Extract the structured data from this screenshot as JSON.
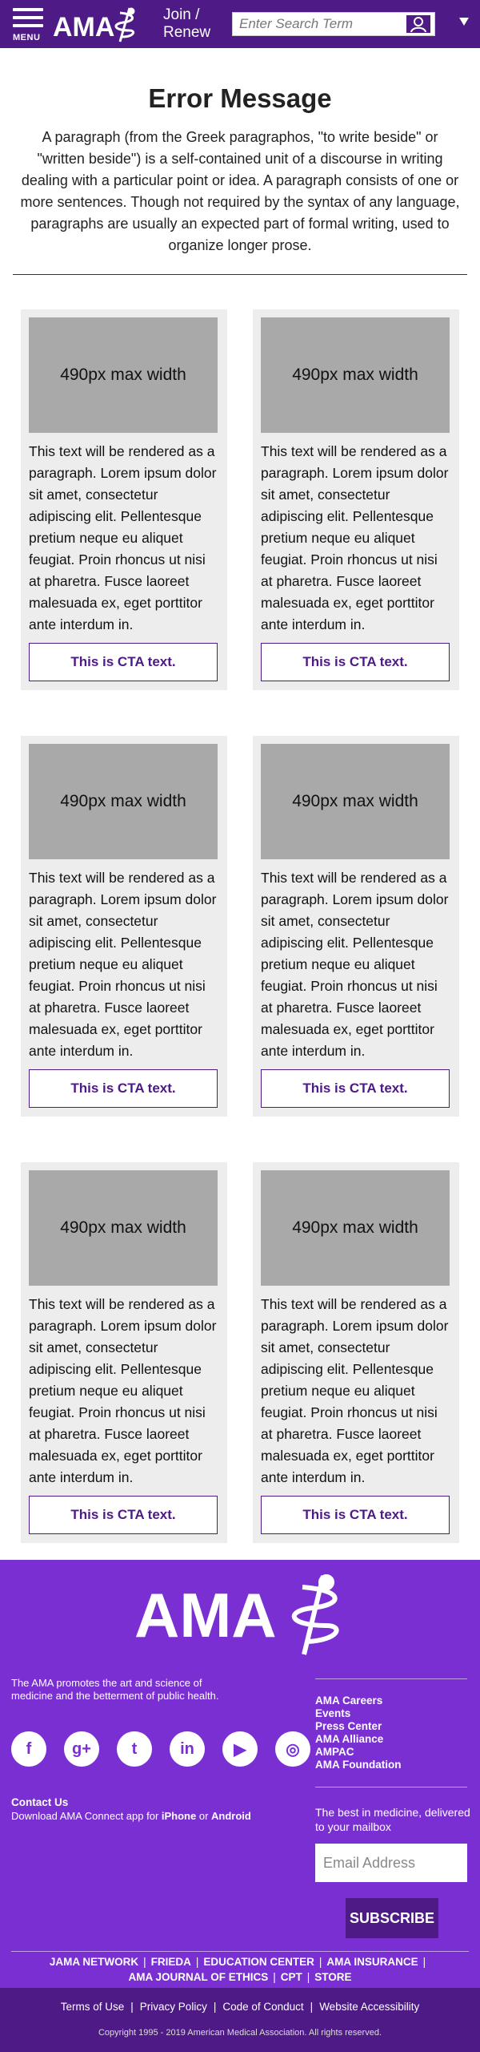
{
  "header": {
    "menu_label": "MENU",
    "logo_text": "AMA",
    "join_line1": "Join /",
    "join_line2": "Renew",
    "search_placeholder": "Enter Search Term",
    "brand_color": "#4d1a86"
  },
  "main": {
    "title": "Error Message",
    "intro": "A paragraph (from the Greek paragraphos, \"to write beside\" or \"written beside\") is a self-contained unit of a discourse in writing dealing with a particular point or idea. A paragraph consists of one or more sentences. Though not required by the syntax of any language, paragraphs are usually an expected part of formal writing, used to organize longer prose.",
    "cards": [
      {
        "image_label": "490px max width",
        "text": "This text will be rendered as a paragraph. Lorem ipsum dolor sit amet, consectetur adipiscing elit. Pellentesque pretium neque eu aliquet feugiat. Proin rhoncus ut nisi at pharetra. Fusce laoreet malesuada ex, eget porttitor ante interdum in.",
        "cta": "This is CTA text."
      },
      {
        "image_label": "490px max width",
        "text": "This text will be rendered as a paragraph. Lorem ipsum dolor sit amet, consectetur adipiscing elit. Pellentesque pretium neque eu aliquet feugiat. Proin rhoncus ut nisi at pharetra. Fusce laoreet malesuada ex, eget porttitor ante interdum in.",
        "cta": "This is CTA text."
      },
      {
        "image_label": "490px max width",
        "text": "This text will be rendered as a paragraph. Lorem ipsum dolor sit amet, consectetur adipiscing elit. Pellentesque pretium neque eu aliquet feugiat. Proin rhoncus ut nisi at pharetra. Fusce laoreet malesuada ex, eget porttitor ante interdum in.",
        "cta": "This is CTA text."
      },
      {
        "image_label": "490px max width",
        "text": "This text will be rendered as a paragraph. Lorem ipsum dolor sit amet, consectetur adipiscing elit. Pellentesque pretium neque eu aliquet feugiat. Proin rhoncus ut nisi at pharetra. Fusce laoreet malesuada ex, eget porttitor ante interdum in.",
        "cta": "This is CTA text."
      },
      {
        "image_label": "490px max width",
        "text": "This text will be rendered as a paragraph. Lorem ipsum dolor sit amet, consectetur adipiscing elit. Pellentesque pretium neque eu aliquet feugiat. Proin rhoncus ut nisi at pharetra. Fusce laoreet malesuada ex, eget porttitor ante interdum in.",
        "cta": "This is CTA text."
      },
      {
        "image_label": "490px max width",
        "text": "This text will be rendered as a paragraph. Lorem ipsum dolor sit amet, consectetur adipiscing elit. Pellentesque pretium neque eu aliquet feugiat. Proin rhoncus ut nisi at pharetra. Fusce laoreet malesuada ex, eget porttitor ante interdum in.",
        "cta": "This is CTA text."
      }
    ]
  },
  "footer": {
    "logo_text": "AMA",
    "mission": "The AMA promotes the art and science of medicine and the betterment of public health.",
    "links": [
      "AMA Careers",
      "Events",
      "Press Center",
      "AMA Alliance",
      "AMPAC",
      "AMA Foundation"
    ],
    "social": [
      {
        "icon": "facebook-icon",
        "glyph": "f"
      },
      {
        "icon": "google-plus-icon",
        "glyph": "g+"
      },
      {
        "icon": "twitter-icon",
        "glyph": "t"
      },
      {
        "icon": "linkedin-icon",
        "glyph": "in"
      },
      {
        "icon": "youtube-icon",
        "glyph": "▶"
      },
      {
        "icon": "instagram-icon",
        "glyph": "◎"
      }
    ],
    "contact_label": "Contact Us",
    "download_prefix": "Download AMA Connect app for ",
    "download_iphone": "iPhone",
    "download_or": " or ",
    "download_android": "Android",
    "newsletter_text": "The best in medicine, delivered to your mailbox",
    "email_placeholder": "Email Address",
    "subscribe_label": "SUBSCRIBE",
    "publications": [
      "JAMA NETWORK",
      "FRIEDA",
      "EDUCATION CENTER",
      "AMA INSURANCE",
      "AMA JOURNAL OF ETHICS",
      "CPT",
      "STORE"
    ],
    "legal_links": [
      "Terms of Use",
      "Privacy Policy",
      "Code of Conduct",
      "Website Accessibility"
    ],
    "copyright": "Copyright 1995 - 2019 American Medical Association. All rights reserved.",
    "footer_color": "#7a2fd3"
  }
}
